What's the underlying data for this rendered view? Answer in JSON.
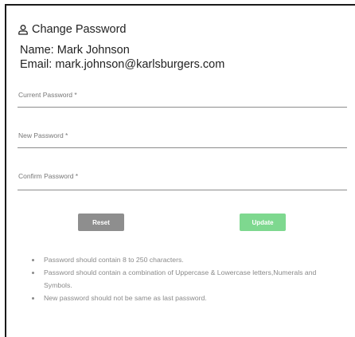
{
  "header": {
    "title": "Change Password",
    "icon": "user-icon"
  },
  "user": {
    "name": "Name: Mark Johnson",
    "email": "Email: mark.johnson@karlsburgers.com"
  },
  "form": {
    "current_password_label": "Current Password *",
    "new_password_label": "New Password *",
    "confirm_password_label": "Confirm Password *",
    "current_password_value": "",
    "new_password_value": "",
    "confirm_password_value": ""
  },
  "buttons": {
    "reset_label": "Reset",
    "update_label": "Update"
  },
  "rules": [
    "Password should contain 8 to 250 characters.",
    "Password should contain a combination of Uppercase & Lowercase letters,Numerals and Symbols.",
    "New password should not be same as last password."
  ],
  "colors": {
    "reset_button": "#8e8e8e",
    "update_button": "#7ed88f",
    "label_text": "#777777",
    "rule_text": "#8a8a8a"
  }
}
